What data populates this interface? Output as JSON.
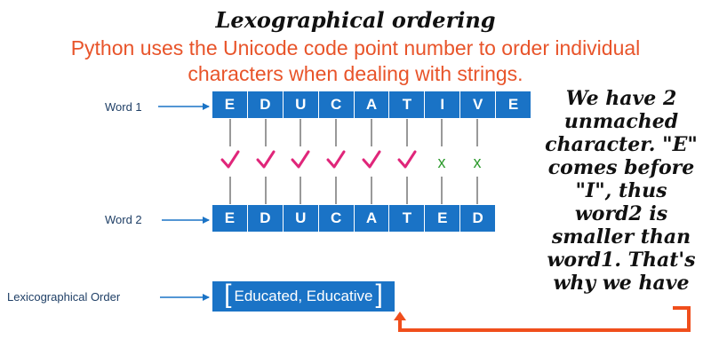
{
  "title": "Lexographical ordering",
  "subtitle": "Python uses the Unicode code point number to order individual characters when dealing with strings.",
  "labels": {
    "word1": "Word 1",
    "word2": "Word 2",
    "order": "Lexicographical Order"
  },
  "word1_letters": [
    "E",
    "D",
    "U",
    "C",
    "A",
    "T",
    "I",
    "V",
    "E"
  ],
  "word2_letters": [
    "E",
    "D",
    "U",
    "C",
    "A",
    "T",
    "E",
    "D"
  ],
  "comparison_marks": [
    "check",
    "check",
    "check",
    "check",
    "check",
    "check",
    "x",
    "x"
  ],
  "x_symbol": "x",
  "result": {
    "open": "[",
    "text": "Educated, Educative",
    "close": "]"
  },
  "note": "We have 2 unmached character. \"E\" comes before \"I\", thus word2 is smaller than word1. That's why we have",
  "colors": {
    "box_blue": "#1a73c6",
    "arrow_blue": "#1a73c6",
    "subtitle_orange": "#e8542a",
    "check_pink": "#e0267a",
    "x_green": "#2e9b2e",
    "connector_orange": "#f04e1c"
  }
}
